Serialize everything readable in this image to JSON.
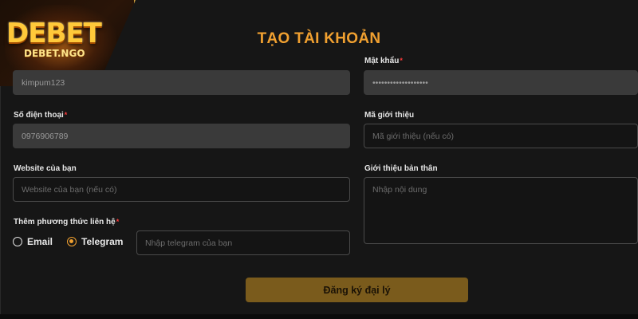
{
  "logo": {
    "brand": "DEBET",
    "domain": "DEBET.NGO"
  },
  "title": "TẠO TÀI KHOẢN",
  "form": {
    "username": {
      "value": "kimpum123"
    },
    "password": {
      "label": "Mật khẩu",
      "value": "•••••••••••••••••••"
    },
    "phone": {
      "label": "Số điện thoại",
      "value": "0976906789"
    },
    "referral": {
      "label": "Mã giới thiệu",
      "placeholder": "Mã giới thiệu (nếu có)"
    },
    "website": {
      "label": "Website của bạn",
      "placeholder": "Website của bạn (nếu có)"
    },
    "intro": {
      "label": "Giới thiệu bản thân",
      "placeholder": "Nhập nội dung"
    },
    "contact": {
      "label": "Thêm phương thức liên hệ",
      "options": [
        "Email",
        "Telegram"
      ],
      "selected": "Telegram",
      "telegram_placeholder": "Nhập telegram của bạn"
    },
    "required_mark": "*",
    "submit_label": "Đăng ký đại lý"
  }
}
